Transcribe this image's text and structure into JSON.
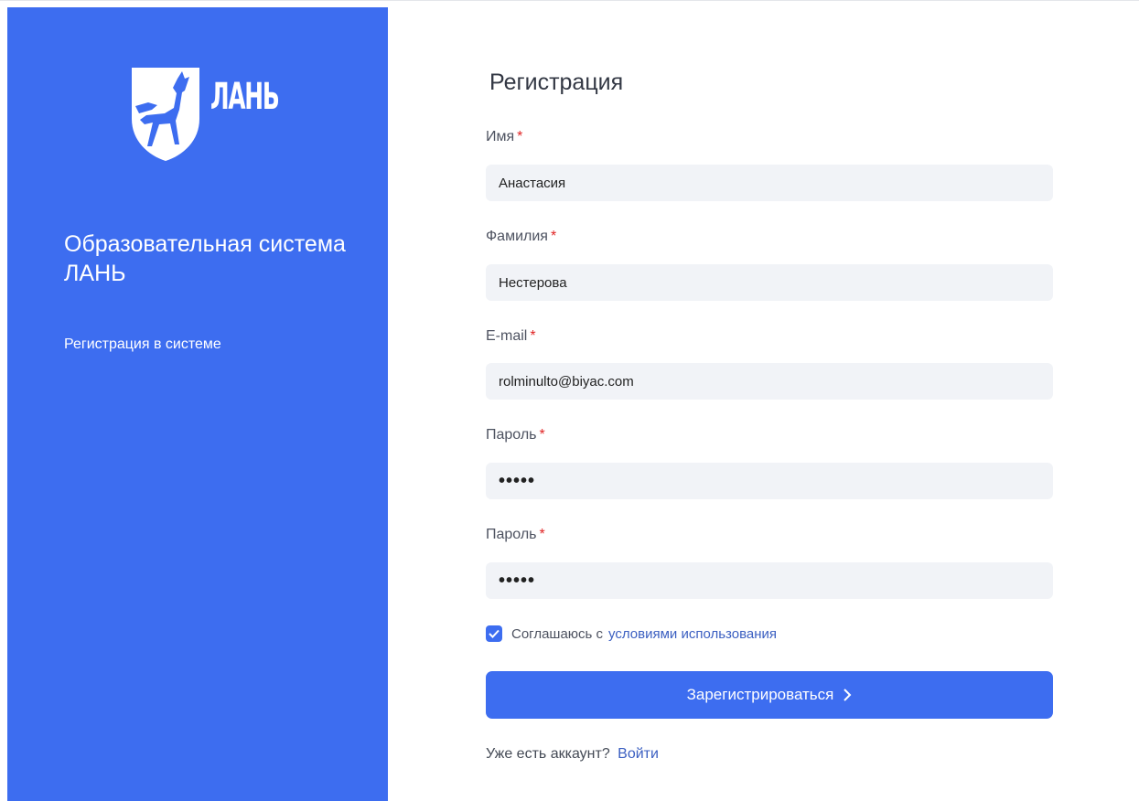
{
  "brand": {
    "logo_text": "ЛАНЬ",
    "system_title": "Образовательная система ЛАНЬ",
    "subtitle": "Регистрация в системе",
    "color_accent": "#3d6df0"
  },
  "form": {
    "title": "Регистрация",
    "required_mark": "*",
    "fields": [
      {
        "label": "Имя",
        "value": "Анастасия"
      },
      {
        "label": "Фамилия",
        "value": "Нестерова"
      },
      {
        "label": "E-mail",
        "value": "rolminulto@biyac.com"
      },
      {
        "label": "Пароль",
        "value": "•••••"
      },
      {
        "label": "Пароль",
        "value": "•••••"
      }
    ],
    "agree": {
      "text": "Соглашаюсь с",
      "link": "условиями использования",
      "checked": true
    },
    "submit_label": "Зарегистрироваться",
    "submit_icon": "chevron-right-icon",
    "login_prompt": "Уже есть аккаунт?",
    "login_link": "Войти"
  }
}
